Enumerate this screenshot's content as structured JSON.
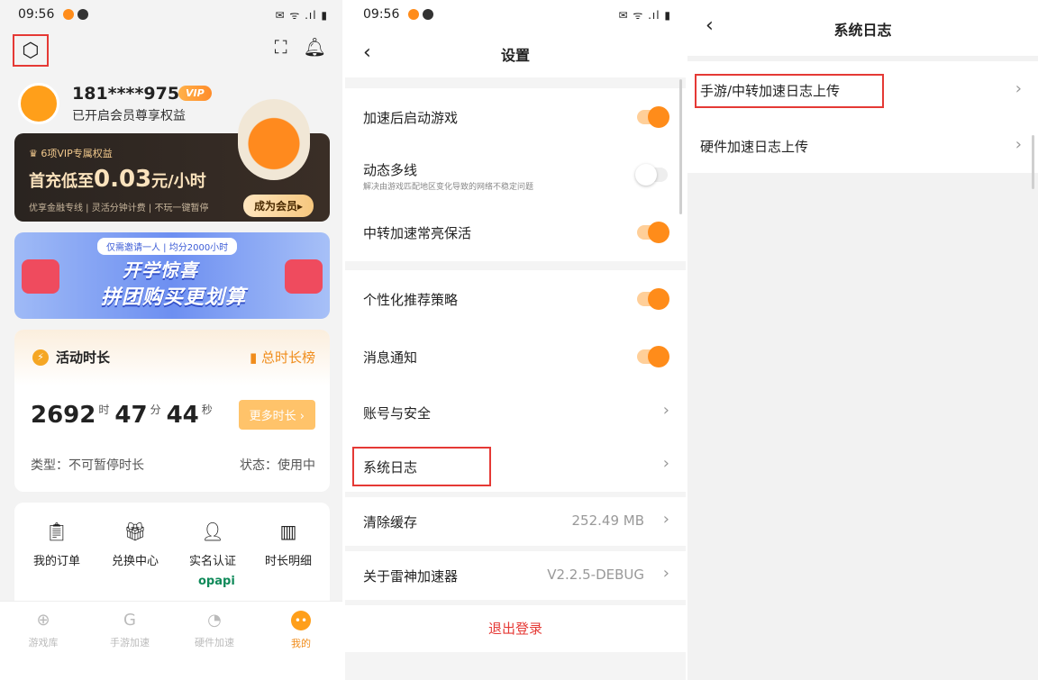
{
  "status": {
    "time": "09:56",
    "system_icons": "✉ ᯤ .ıl ▮"
  },
  "me": {
    "phone": "181****9759",
    "vip_badge": "VIP",
    "member_sub": "已开启会员尊享权益",
    "vip_card": {
      "tag": "6项VIP专属权益",
      "title_prefix": "首充低至",
      "price": "0.03",
      "unit": "元/小时",
      "features": "优享金融专线 | 灵活分钟计费 | 不玩一键暂停",
      "button": "成为会员▸"
    },
    "banner": {
      "pill": "仅需邀请一人 | 均分2000小时",
      "line1": "开学惊喜",
      "line2": "拼团购买更划算"
    },
    "activity": {
      "title": "活动时长",
      "rank": "总时长榜",
      "hours": "2692",
      "hours_unit": "时",
      "minutes": "47",
      "minutes_unit": "分",
      "seconds": "44",
      "seconds_unit": "秒",
      "more": "更多时长 ›",
      "type": "类型：不可暂停时长",
      "status": "状态：使用中"
    },
    "grid": [
      "我的订单",
      "兑换中心",
      "实名认证",
      "时长明细"
    ],
    "opapi": "opapi",
    "tabs": [
      "游戏库",
      "手游加速",
      "硬件加速",
      "我的"
    ]
  },
  "settings": {
    "title": "设置",
    "rows": [
      {
        "label": "加速后启动游戏"
      },
      {
        "label": "动态多线",
        "desc": "解决由游戏匹配地区变化导致的网络不稳定问题"
      },
      {
        "label": "中转加速常亮保活"
      },
      {
        "label": "个性化推荐策略"
      },
      {
        "label": "消息通知"
      },
      {
        "label": "账号与安全"
      },
      {
        "label": "系统日志"
      },
      {
        "label": "清除缓存",
        "value": "252.49 MB"
      },
      {
        "label": "关于雷神加速器",
        "value": "V2.2.5-DEBUG"
      }
    ],
    "logout": "退出登录"
  },
  "syslog": {
    "title": "系统日志",
    "rows": [
      "手游/中转加速日志上传",
      "硬件加速日志上传"
    ]
  },
  "colors": {
    "accent": "#ff8c1a",
    "highlight": "#e53935"
  }
}
